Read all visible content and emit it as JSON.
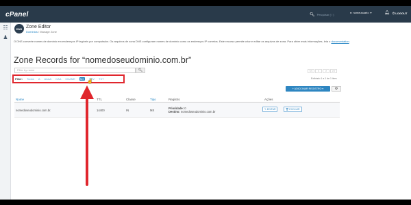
{
  "topnav": {
    "logo": "cPanel",
    "search_placeholder": "Pesquisar ( / )",
    "username": "nomeusuario",
    "logout": "LOGOUT"
  },
  "header": {
    "logo_text": "DNS",
    "title": "Zone Editor",
    "breadcrumb_domains": "Domínios",
    "breadcrumb_sep": "/",
    "breadcrumb_current": "Manage Zone"
  },
  "description": {
    "text": "O DNS converte nomes de domínio em endereços IP legíveis por computador. Os arquivos de zona DNS configuram nomes de domínio como os endereços IP corretos. Este recurso permite criar e editar os arquivos de zona. Para obter mais informações, leia o",
    "link": "documentation"
  },
  "zone_heading": "Zone Records for “nomedoseudominio.com.br”",
  "filter_input": {
    "placeholder": "Filter by name"
  },
  "filter": {
    "label": "Filter:",
    "options": [
      "Todos",
      "A",
      "AAAA",
      "CAA",
      "CNAME",
      "MX",
      "SRV",
      "TXT"
    ],
    "active_index": 5
  },
  "pager": {
    "buttons": [
      "<<",
      "<",
      ">",
      ">>"
    ],
    "info": "Exibindo 1 a 1 de 1 item"
  },
  "add_record_label": "+ ADICIONAR REGISTRO  ▾",
  "table": {
    "headers": [
      "Nome",
      "TTL",
      "Classe",
      "Tipo",
      "Registro",
      "Ações"
    ],
    "rows": [
      {
        "name": "nomedoseudominio.com.br.",
        "ttl": "14400",
        "class": "IN",
        "type": "MX",
        "priority_label": "Prioridade:",
        "priority_value": "0",
        "destination_label": "Destino:",
        "destination_value": "nomedoseudominio.com.br",
        "edit_label": "✎ EDITAR",
        "delete_label": "🗑 EXCLUIR"
      }
    ]
  },
  "colors": {
    "nav_bg": "#293a4a",
    "accent": "#2e86c1",
    "highlight_red": "#e0262d"
  },
  "icons": {
    "sidebar_top": "grid-icon",
    "sidebar_bottom": "users-icon",
    "search": "search-icon",
    "user": "user-icon",
    "bell": "bell-icon",
    "logout": "logout-icon",
    "gear": "gear-icon"
  }
}
